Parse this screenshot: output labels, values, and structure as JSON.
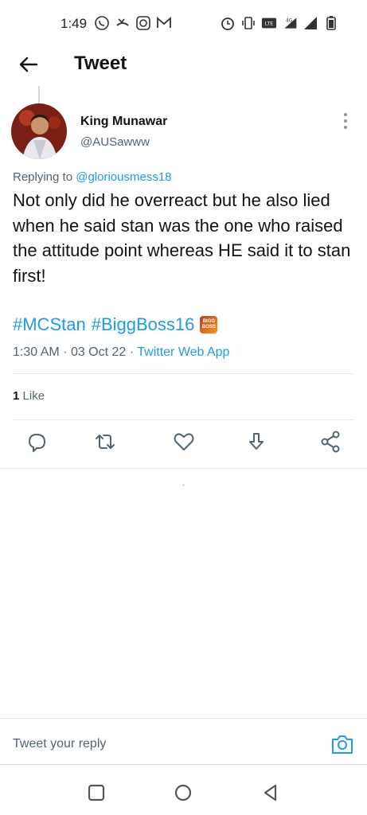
{
  "status_bar": {
    "time": "1:49",
    "left_icons": [
      "whatsapp-icon",
      "missed-call-icon",
      "instagram-icon",
      "gmail-icon"
    ],
    "right_icons": [
      "alarm-icon",
      "vibrate-icon",
      "volte-icon",
      "signal-4g-icon",
      "signal-icon",
      "battery-icon"
    ]
  },
  "header": {
    "title": "Tweet"
  },
  "tweet": {
    "author_name": "King Munawar",
    "author_handle": "@AUSawww",
    "replying_prefix": "Replying to",
    "replying_to": "@gloriousmess18",
    "text": "Not only did he overreact but he also lied when he said stan was the one who raised the attitude point whereas HE said it to stan first!",
    "hashtags": [
      "#MCStan",
      "#BiggBoss16"
    ],
    "emoji_text": "BIGG BOSS",
    "time": "1:30 AM",
    "separator": "·",
    "date": "03 Oct 22",
    "source": "Twitter Web App",
    "likes_count": "1",
    "likes_label": "Like"
  },
  "actions": [
    "reply-icon",
    "retweet-icon",
    "like-icon",
    "bookmark-icon",
    "share-icon"
  ],
  "reply_bar": {
    "placeholder": "Tweet your reply"
  },
  "colors": {
    "accent": "#1d9bf0",
    "text": "#0f1419",
    "muted": "#536471"
  }
}
